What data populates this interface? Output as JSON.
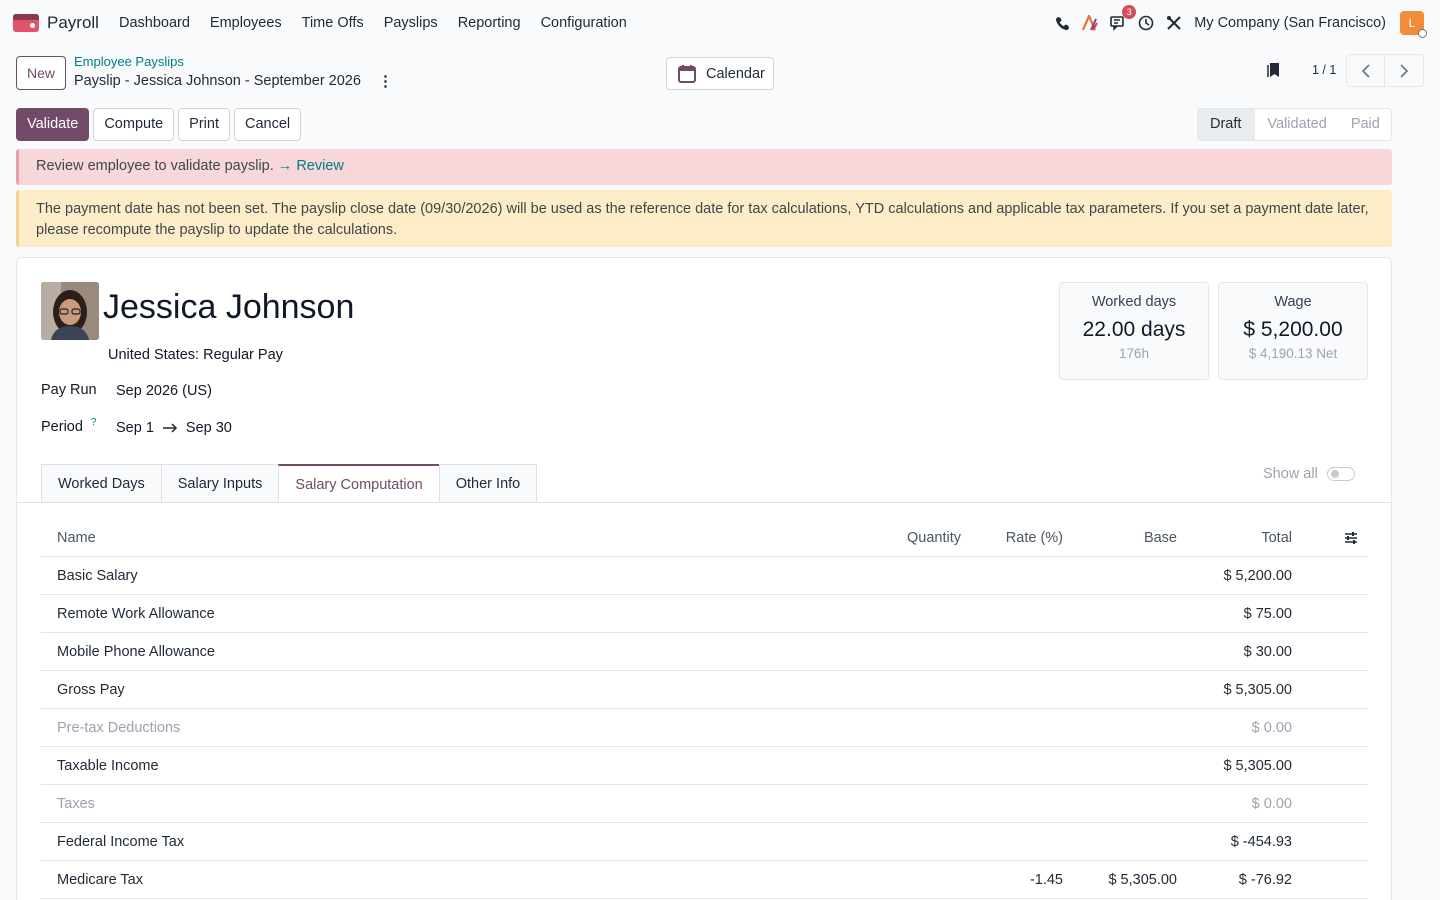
{
  "navbar": {
    "app_name": "Payroll",
    "menu": [
      "Dashboard",
      "Employees",
      "Time Offs",
      "Payslips",
      "Reporting",
      "Configuration"
    ],
    "messages_badge": "3",
    "company": "My Company (San Francisco)",
    "user_initial": "L"
  },
  "control": {
    "new_label": "New",
    "breadcrumb": "Employee Payslips",
    "record_title": "Payslip - Jessica Johnson - September 2026",
    "calendar_label": "Calendar",
    "pager": "1 / 1"
  },
  "actions": {
    "validate": "Validate",
    "compute": "Compute",
    "print": "Print",
    "cancel": "Cancel"
  },
  "status": {
    "steps": [
      "Draft",
      "Validated",
      "Paid"
    ],
    "current": "Draft"
  },
  "alerts": {
    "review_text": "Review employee to validate payslip.",
    "review_link": "→ Review",
    "warning_text": "The payment date has not been set. The payslip close date (09/30/2026) will be used as the reference date for tax calculations, YTD calculations and applicable tax parameters. If you set a payment date later, please recompute the payslip to update the calculations."
  },
  "employee": {
    "name": "Jessica Johnson",
    "structure": "United States: Regular Pay",
    "pay_run_label": "Pay Run",
    "pay_run_value": "Sep 2026 (US)",
    "period_label": "Period",
    "period_help": "?",
    "period_start": "Sep 1",
    "period_end": "Sep 30"
  },
  "stats": {
    "worked_days_title": "Worked days",
    "worked_days_value": "22.00 days",
    "worked_days_sub": "176h",
    "wage_title": "Wage",
    "wage_value": "$ 5,200.00",
    "wage_sub": "$ 4,190.13 Net"
  },
  "tabs": [
    "Worked Days",
    "Salary Inputs",
    "Salary Computation",
    "Other Info"
  ],
  "active_tab": "Salary Computation",
  "show_all_label": "Show all",
  "table": {
    "headers": {
      "name": "Name",
      "quantity": "Quantity",
      "rate": "Rate (%)",
      "base": "Base",
      "total": "Total"
    },
    "rows": [
      {
        "name": "Basic Salary",
        "quantity": "",
        "rate": "",
        "base": "",
        "total": "$ 5,200.00"
      },
      {
        "name": "Remote Work Allowance",
        "quantity": "",
        "rate": "",
        "base": "",
        "total": "$ 75.00"
      },
      {
        "name": "Mobile Phone Allowance",
        "quantity": "",
        "rate": "",
        "base": "",
        "total": "$ 30.00"
      },
      {
        "name": "Gross Pay",
        "quantity": "",
        "rate": "",
        "base": "",
        "total": "$ 5,305.00"
      },
      {
        "name": "Pre-tax Deductions",
        "quantity": "",
        "rate": "",
        "base": "",
        "total": "$ 0.00"
      },
      {
        "name": "Taxable Income",
        "quantity": "",
        "rate": "",
        "base": "",
        "total": "$ 5,305.00"
      },
      {
        "name": "Taxes",
        "quantity": "",
        "rate": "",
        "base": "",
        "total": "$ 0.00"
      },
      {
        "name": "Federal Income Tax",
        "quantity": "",
        "rate": "",
        "base": "",
        "total": "$ -454.93"
      },
      {
        "name": "Medicare Tax",
        "quantity": "",
        "rate": "-1.45",
        "base": "$ 5,305.00",
        "total": "$ -76.92"
      }
    ]
  },
  "colors": {
    "brand": "#714B67",
    "link": "#017e84",
    "danger_bg": "#f8d7da",
    "warning_bg": "#fdecc8"
  }
}
